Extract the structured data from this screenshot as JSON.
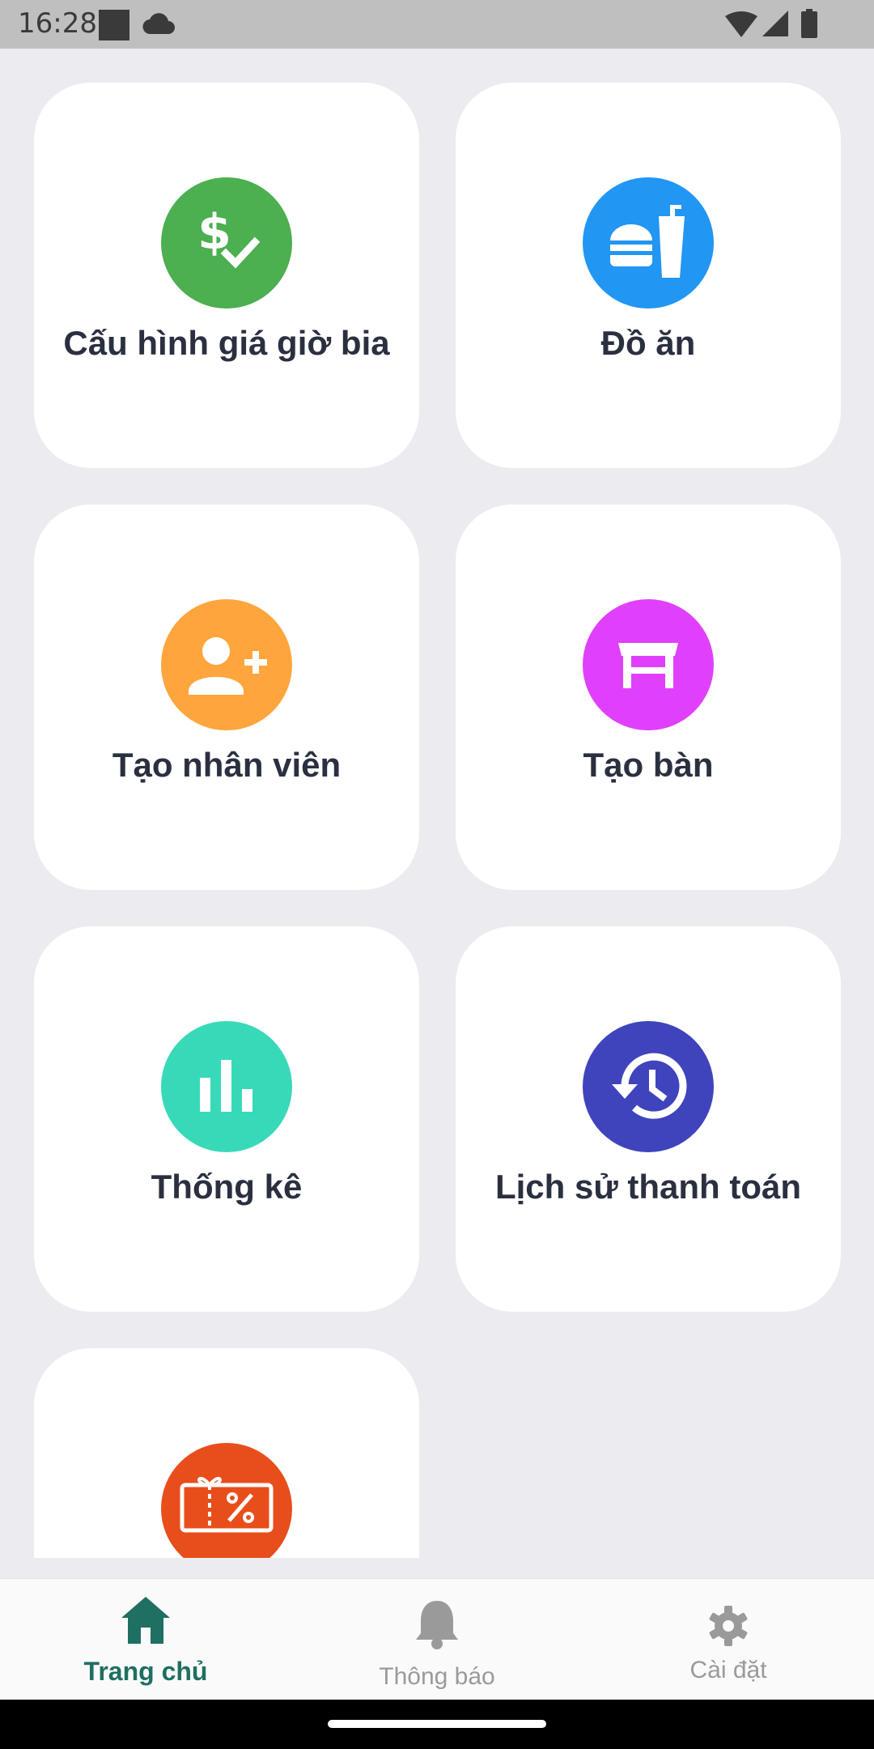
{
  "status_bar": {
    "time": "16:28",
    "icons": [
      "notification-square-icon",
      "cloud-icon",
      "wifi-icon",
      "cell-signal-icon",
      "battery-icon"
    ]
  },
  "tiles": [
    {
      "label": "Cấu hình giá giờ bia",
      "icon": "dollar-check-icon",
      "color": "#4caf50"
    },
    {
      "label": "Đồ ăn",
      "icon": "fastfood-icon",
      "color": "#2196f3"
    },
    {
      "label": "Tạo nhân viên",
      "icon": "person-add-icon",
      "color": "#ffa53d"
    },
    {
      "label": "Tạo bàn",
      "icon": "table-icon",
      "color": "#e040fb"
    },
    {
      "label": "Thống kê",
      "icon": "bar-chart-icon",
      "color": "#38d9b9"
    },
    {
      "label": "Lịch sử thanh toán",
      "icon": "history-icon",
      "color": "#3f44bd"
    },
    {
      "label": "",
      "icon": "voucher-icon",
      "color": "#e84e1b"
    }
  ],
  "bottom_nav": {
    "active_color": "#1f6f62",
    "inactive_color": "#9a9a9a",
    "items": [
      {
        "label": "Trang chủ",
        "icon": "home-icon",
        "active": true
      },
      {
        "label": "Thông báo",
        "icon": "bell-icon",
        "active": false
      },
      {
        "label": "Cài đặt",
        "icon": "gear-icon",
        "active": false
      }
    ]
  }
}
